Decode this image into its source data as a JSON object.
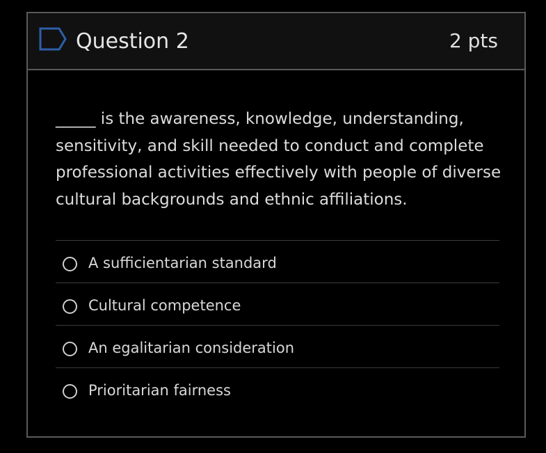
{
  "question": {
    "title": "Question 2",
    "points": "2 pts",
    "prompt": "_____ is the awareness, knowledge, understanding, sensitivity, and skill needed to conduct and complete professional activities effectively with people of diverse cultural backgrounds and ethnic affiliations.",
    "flag_icon": "bookmark-flag-icon",
    "answers": [
      {
        "label": "A sufficientarian standard"
      },
      {
        "label": "Cultural competence"
      },
      {
        "label": "An egalitarian consideration"
      },
      {
        "label": "Prioritarian fairness"
      }
    ]
  },
  "colors": {
    "background": "#000000",
    "header_background": "#111111",
    "border": "#5a5a5a",
    "flag": "#2d5fa8",
    "text": "#dcdcdc"
  }
}
